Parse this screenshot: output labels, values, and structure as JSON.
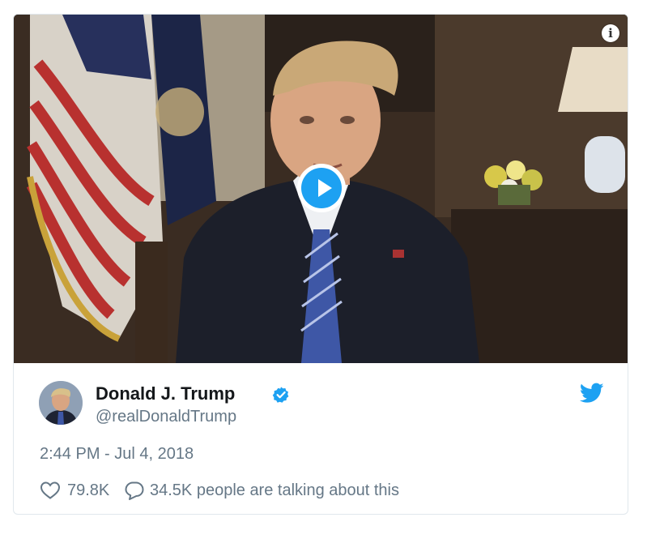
{
  "tweet": {
    "display_name": "Donald J. Trump",
    "handle": "@realDonaldTrump",
    "timestamp": "2:44 PM - Jul 4, 2018",
    "likes": "79.8K",
    "conversation": "34.5K people are talking about this",
    "verified": true
  },
  "media": {
    "type": "video",
    "info_glyph": "i"
  },
  "icons": {
    "play": "play-icon",
    "info": "info-icon",
    "verified": "verified-badge-icon",
    "twitter": "twitter-bird-icon",
    "like": "heart-icon",
    "reply": "reply-bubble-icon"
  },
  "colors": {
    "accent": "#1da1f2",
    "text_primary": "#14171a",
    "text_secondary": "#657786",
    "border": "#e1e8ed"
  }
}
